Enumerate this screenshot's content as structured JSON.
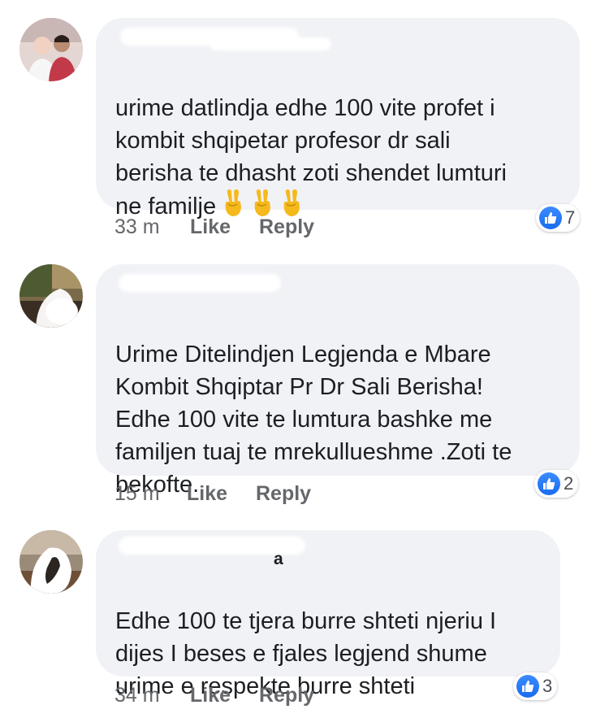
{
  "comments": [
    {
      "author_visible": "",
      "text": "urime datlindja edhe 100 vite  profet i\nkombit shqipetar profesor dr sali\nberisha te dhasht zoti shendet lumturi\nne familje",
      "emoji": [
        "victory-hand",
        "victory-hand",
        "victory-hand"
      ],
      "time": "33 m",
      "like_label": "Like",
      "reply_label": "Reply",
      "reaction_count": "7"
    },
    {
      "author_visible": "",
      "text": "Urime Ditelindjen Legjenda e Mbare\nKombit Shqiptar Pr Dr Sali Berisha!\nEdhe 100 vite te lumtura bashke me\nfamiljen tuaj te mrekullueshme .Zoti te\nbekofte.",
      "time": "15 m",
      "like_label": "Like",
      "reply_label": "Reply",
      "reaction_count": "2"
    },
    {
      "author_visible": "a",
      "text": "Edhe 100 te tjera burre shteti njeriu I\ndijes I beses e fjales legjend shume\nurime e respekte burre shteti",
      "time": "34 m",
      "like_label": "Like",
      "reply_label": "Reply",
      "reaction_count": "3"
    }
  ],
  "colors": {
    "bubble": "#f1f2f6",
    "text": "#1c1e21",
    "meta": "#65676b",
    "like_blue": "#1a6bf0"
  }
}
